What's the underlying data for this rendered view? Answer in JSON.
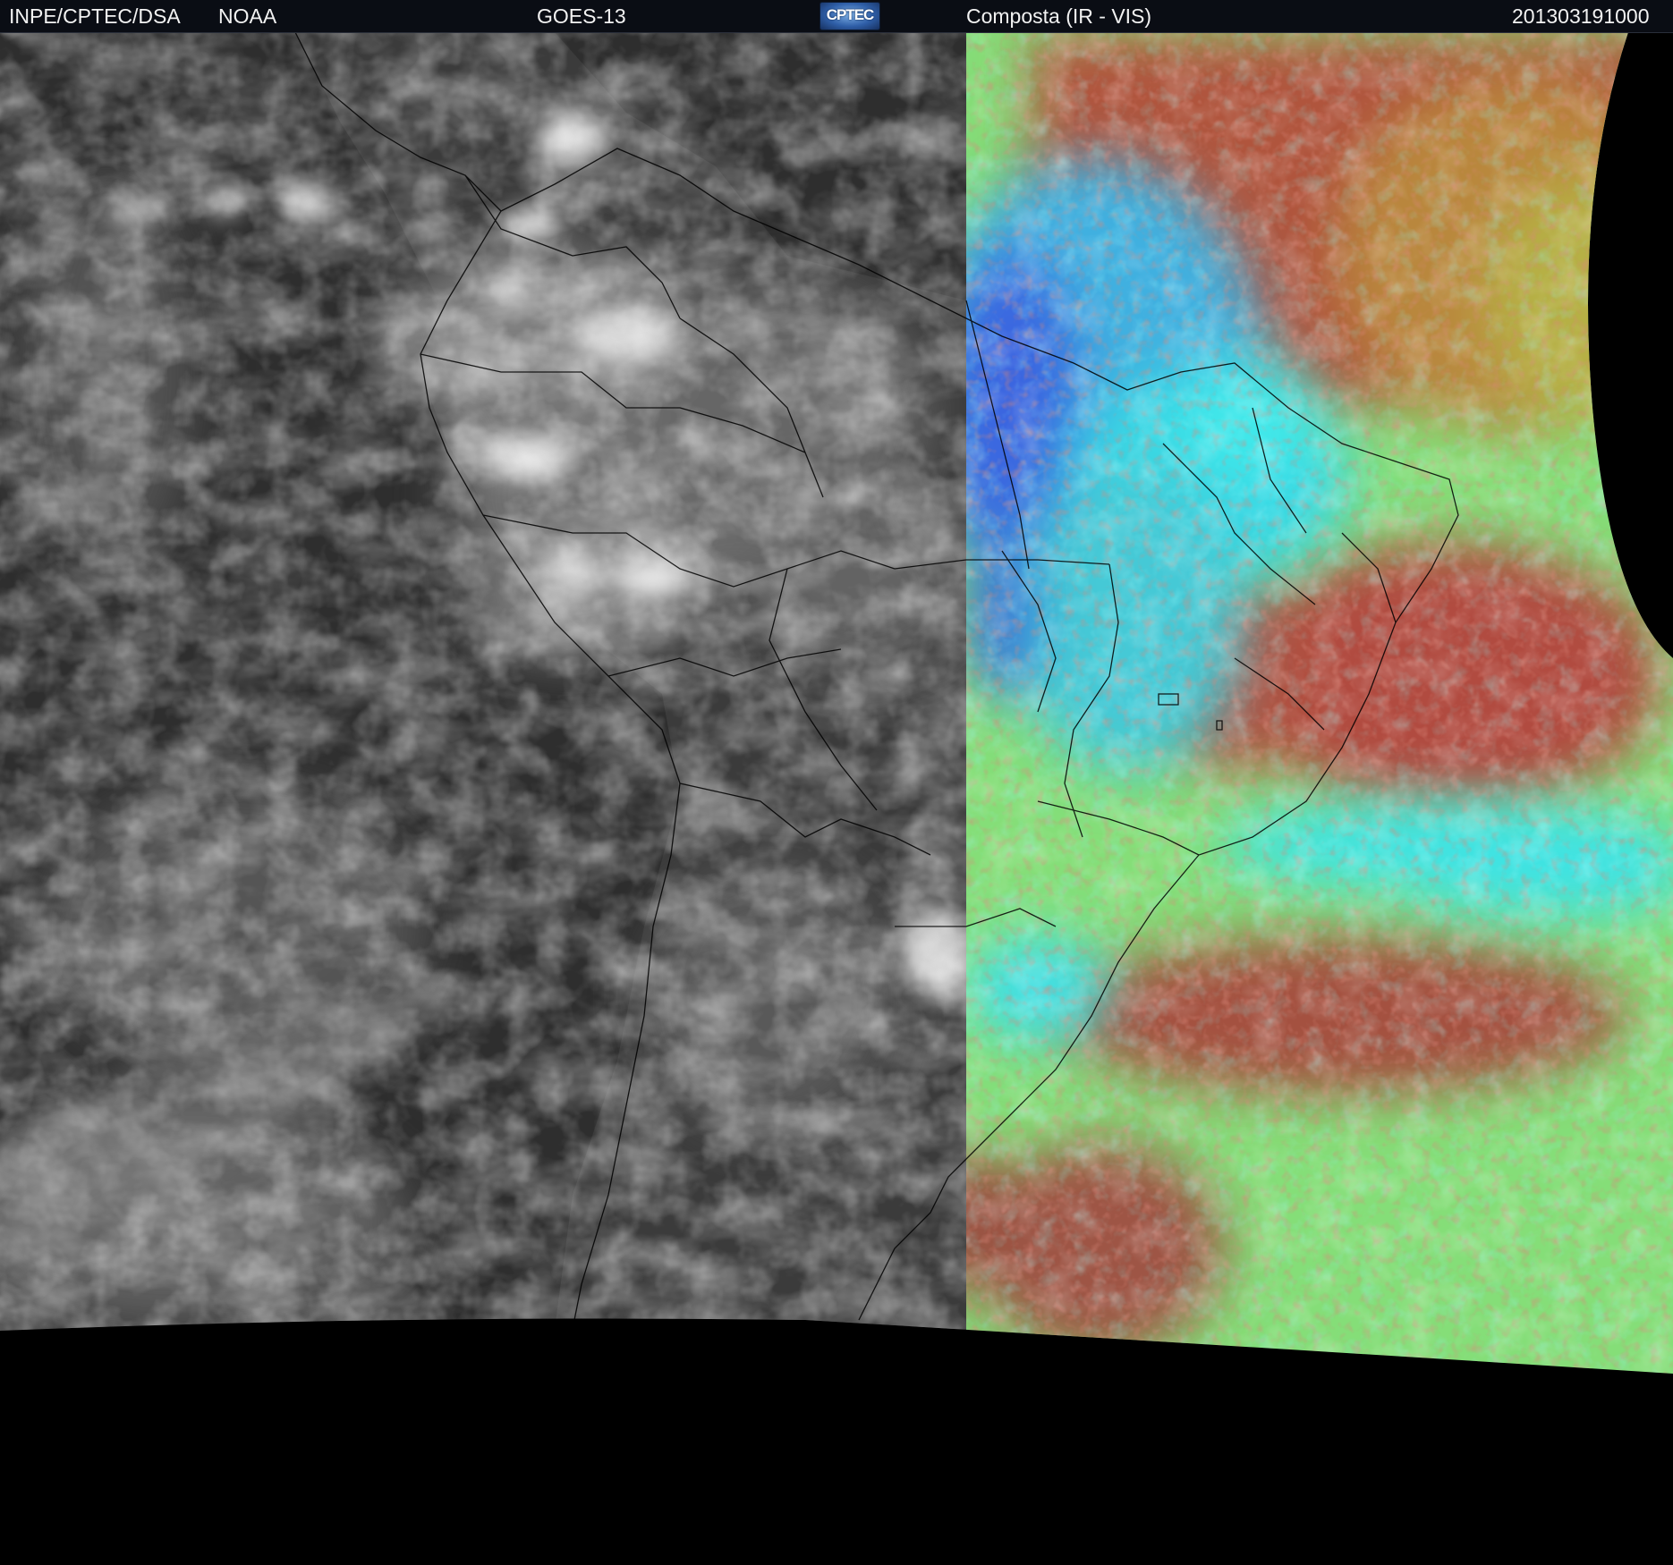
{
  "header": {
    "source_left": "INPE/CPTEC/DSA",
    "agency": "NOAA",
    "satellite": "GOES-13",
    "logo_text": "CPTEC",
    "product": "Composta (IR - VIS)",
    "timestamp": "201303191000"
  },
  "map": {
    "region": "South America",
    "ir_panel_style": "grayscale infrared",
    "vis_panel_style": "false-color composite",
    "colors": {
      "ocean_ir": "#2e2e2e",
      "land_ir": "#3a3a3a",
      "cloud_ir": "#d8d8d8",
      "composite_red": "#b44a3e",
      "composite_green": "#86e27a",
      "composite_cyan": "#3fe6e6",
      "composite_blue": "#3a6ae0",
      "border_lines": "#000000",
      "space": "#000000"
    }
  }
}
